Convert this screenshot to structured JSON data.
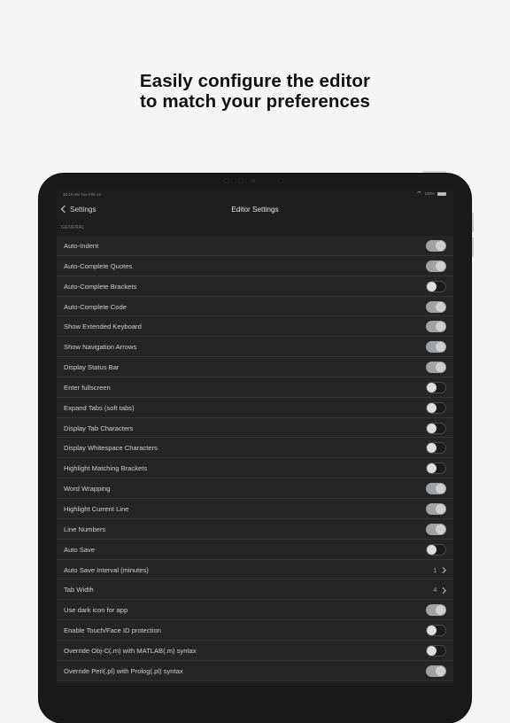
{
  "headline": {
    "line1": "Easily configure the editor",
    "line2": "to match your preferences"
  },
  "statusbar": {
    "time": "10:10 AM  Tue Feb 12",
    "battery": "100%"
  },
  "nav": {
    "back_label": "Settings",
    "title": "Editor Settings"
  },
  "section": {
    "header": "GENERAL"
  },
  "colors": {
    "toggle_on": "#9ca3a9",
    "toggle_off": "#1c1c1c",
    "row_bg": "#252525"
  },
  "rows": [
    {
      "label": "Auto-Indent",
      "type": "toggle",
      "on": true
    },
    {
      "label": "Auto-Complete Quotes",
      "type": "toggle",
      "on": true
    },
    {
      "label": "Auto-Complete Brackets",
      "type": "toggle",
      "on": false
    },
    {
      "label": "Auto-Complete Code",
      "type": "toggle",
      "on": true
    },
    {
      "label": "Show Extended Keyboard",
      "type": "toggle",
      "on": true
    },
    {
      "label": "Show Navigation Arrows",
      "type": "toggle",
      "on": true
    },
    {
      "label": "Display Status Bar",
      "type": "toggle",
      "on": true
    },
    {
      "label": "Enter fullscreen",
      "type": "toggle",
      "on": false
    },
    {
      "label": "Expand Tabs (soft tabs)",
      "type": "toggle",
      "on": false
    },
    {
      "label": "Display Tab Characters",
      "type": "toggle",
      "on": false
    },
    {
      "label": "Display Whitespace Characters",
      "type": "toggle",
      "on": false
    },
    {
      "label": "Highlight Matching Brackets",
      "type": "toggle",
      "on": false
    },
    {
      "label": "Word Wrapping",
      "type": "toggle",
      "on": true
    },
    {
      "label": "Highlight Current Line",
      "type": "toggle",
      "on": true
    },
    {
      "label": "Line Numbers",
      "type": "toggle",
      "on": true
    },
    {
      "label": "Auto Save",
      "type": "toggle",
      "on": false
    },
    {
      "label": "Auto Save Interval (minutes)",
      "type": "value",
      "value": "1"
    },
    {
      "label": "Tab Width",
      "type": "value",
      "value": "4"
    },
    {
      "label": "Use dark icon for app",
      "type": "toggle",
      "on": true
    },
    {
      "label": "Enable Touch/Face ID protection",
      "type": "toggle",
      "on": false
    },
    {
      "label": "Override Obj-C(.m) with MATLAB(.m) syntax",
      "type": "toggle",
      "on": false
    },
    {
      "label": "Override Perl(.pl) with Prolog(.pl) syntax",
      "type": "toggle",
      "on": true
    }
  ]
}
